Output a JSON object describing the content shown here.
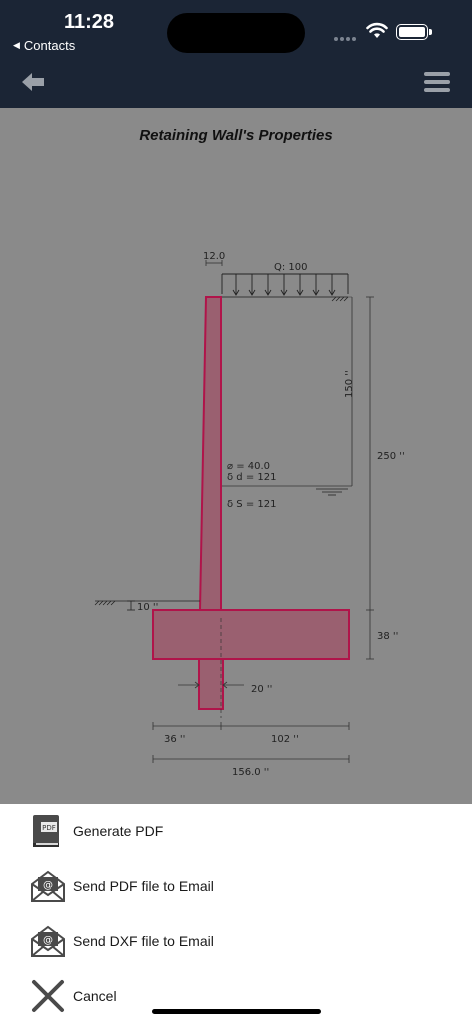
{
  "status_bar": {
    "time": "11:28",
    "back_app": "Contacts"
  },
  "nav": {
    "back_icon": "arrow-left-icon",
    "menu_icon": "hamburger-menu-icon"
  },
  "page": {
    "title": "Retaining Wall's Properties"
  },
  "drawing": {
    "stem_top_width": "12.0",
    "surcharge": "Q: 100",
    "retained_height": "150 ''",
    "total_height": "250 ''",
    "phi": "⌀ = 40.0",
    "delta_d": "δ d = 121",
    "delta_s": "δ S = 121",
    "front_soil": "10 ''",
    "base_thickness": "38 ''",
    "key_width": "20 ''",
    "toe_width": "36 ''",
    "heel_width": "102 ''",
    "base_width": "156.0 ''",
    "wall_color": "#b0144a"
  },
  "action_sheet": {
    "items": [
      {
        "label": "Generate PDF",
        "icon": "pdf-book-icon",
        "icon_text": "PDF"
      },
      {
        "label": "Send PDF file to Email",
        "icon": "email-envelope-icon",
        "icon_text": "@"
      },
      {
        "label": "Send DXF file to Email",
        "icon": "email-envelope-icon",
        "icon_text": "@"
      },
      {
        "label": "Cancel",
        "icon": "close-icon"
      }
    ]
  }
}
